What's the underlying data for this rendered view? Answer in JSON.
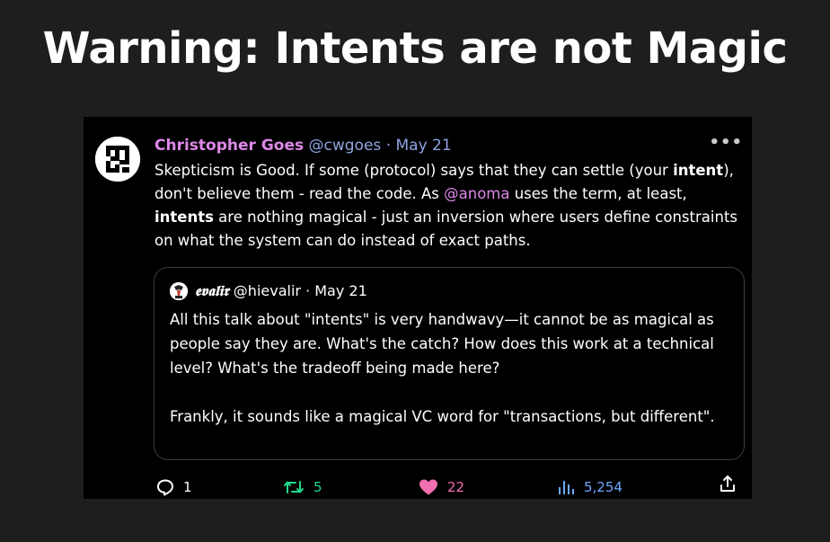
{
  "slide": {
    "title": "Warning: Intents are not Magic"
  },
  "tweet": {
    "author_name": "Christopher Goes",
    "handle": "@cwgoes",
    "separator": "·",
    "date": "May 21",
    "more_icon": "more-dots-icon",
    "body": {
      "part1": "Skepticism is Good. If some (protocol) says that they can settle (your ",
      "bold1": "intent",
      "part2": "), don't believe them - read the code. As ",
      "mention": "@anoma",
      "part3": " uses the term, at least, ",
      "bold2": "intents",
      "part4": " are nothing magical - just an inversion where users define constraints on what the system can do instead of exact paths."
    },
    "quoted": {
      "author_name": "𝖊𝖛𝖆𝖑𝖎𝖗",
      "handle": "@hievalir",
      "separator": "·",
      "date": "May 21",
      "paragraph1": "All this talk about \"intents\" is very handwavy—it cannot be as magical as people say they are. What's the catch? How does this work at a technical level? What's the tradeoff being made here?",
      "paragraph2": "Frankly, it sounds like a magical VC word for \"transactions, but different\"."
    },
    "actions": {
      "replies": "1",
      "retweets": "5",
      "likes": "22",
      "views": "5,254"
    },
    "colors": {
      "name": "#dd88e8",
      "meta": "#8ea4e0",
      "retweet": "#1fd98c",
      "like": "#f26fb1",
      "views": "#6ea8ff"
    }
  }
}
